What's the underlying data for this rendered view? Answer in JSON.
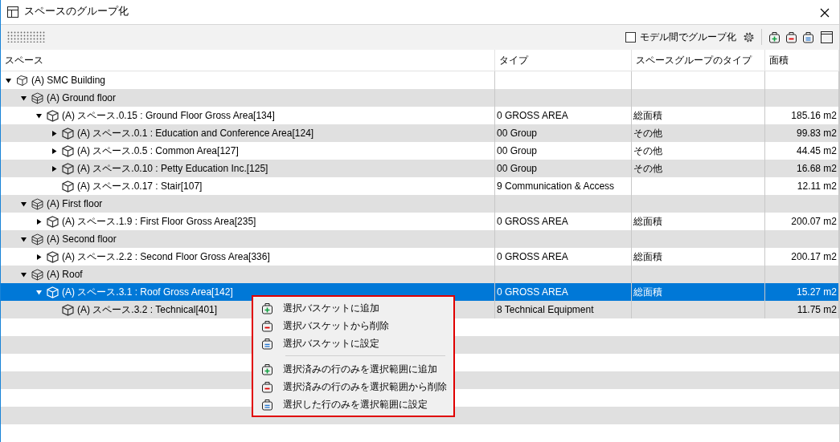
{
  "window": {
    "title": "スペースのグループ化"
  },
  "toolbar": {
    "cross_model": {
      "label": "モデル間でグループ化",
      "checked": false
    }
  },
  "table": {
    "columns": [
      "スペース",
      "タイプ",
      "スペースグループのタイプ",
      "面積"
    ],
    "rows": [
      {
        "kind": "building",
        "label": "(A) SMC Building",
        "expanded": true,
        "selected": false,
        "children": [
          {
            "kind": "floor",
            "label": "(A) Ground floor",
            "expanded": true,
            "selected": false,
            "children": [
              {
                "kind": "space",
                "label": "(A) スペース.0.15 : Ground Floor Gross Area[134]",
                "type": "0 GROSS AREA",
                "group_type": "総面積",
                "area": "185.16 m2",
                "expanded": true,
                "selected": false,
                "children": [
                  {
                    "kind": "space",
                    "label": "(A) スペース.0.1 : Education and Conference Area[124]",
                    "type": "00 Group",
                    "group_type": "その他",
                    "area": "99.83 m2",
                    "expanded": false,
                    "selected": false
                  },
                  {
                    "kind": "space",
                    "label": "(A) スペース.0.5 : Common Area[127]",
                    "type": "00 Group",
                    "group_type": "その他",
                    "area": "44.45 m2",
                    "expanded": false,
                    "selected": false
                  },
                  {
                    "kind": "space",
                    "label": "(A) スペース.0.10 : Petty Education Inc.[125]",
                    "type": "00 Group",
                    "group_type": "その他",
                    "area": "16.68 m2",
                    "expanded": false,
                    "selected": false
                  },
                  {
                    "kind": "space",
                    "label": "(A) スペース.0.17 : Stair[107]",
                    "type": "9 Communication & Access",
                    "area": "12.11 m2",
                    "selected": false
                  }
                ]
              }
            ]
          },
          {
            "kind": "floor",
            "label": "(A) First floor",
            "expanded": true,
            "selected": false,
            "children": [
              {
                "kind": "space",
                "label": "(A) スペース.1.9 : First Floor Gross Area[235]",
                "type": "0 GROSS AREA",
                "group_type": "総面積",
                "area": "200.07 m2",
                "expanded": false,
                "selected": false
              }
            ]
          },
          {
            "kind": "floor",
            "label": "(A) Second floor",
            "expanded": true,
            "selected": false,
            "children": [
              {
                "kind": "space",
                "label": "(A) スペース.2.2 : Second Floor Gross Area[336]",
                "type": "0 GROSS AREA",
                "group_type": "総面積",
                "area": "200.17 m2",
                "expanded": false,
                "selected": false
              }
            ]
          },
          {
            "kind": "floor",
            "label": "(A) Roof",
            "expanded": true,
            "selected": false,
            "children": [
              {
                "kind": "space",
                "label": "(A) スペース.3.1 : Roof Gross Area[142]",
                "type": "0 GROSS AREA",
                "group_type": "総面積",
                "area": "15.27 m2",
                "expanded": true,
                "selected": true,
                "children": [
                  {
                    "kind": "space",
                    "label": "(A) スペース.3.2 : Technical[401]",
                    "type": "8 Technical Equipment",
                    "area": "11.75 m2",
                    "selected": false
                  }
                ]
              }
            ]
          }
        ]
      }
    ]
  },
  "context_menu": {
    "groups": [
      [
        {
          "kind": "add",
          "label": "選択バスケットに追加"
        },
        {
          "kind": "remove",
          "label": "選択バスケットから削除"
        },
        {
          "kind": "set",
          "label": "選択バスケットに設定"
        }
      ],
      [
        {
          "kind": "add",
          "label": "選択済みの行のみを選択範囲に追加"
        },
        {
          "kind": "remove",
          "label": "選択済みの行のみを選択範囲から削除"
        },
        {
          "kind": "set",
          "label": "選択した行のみを選択範囲に設定"
        }
      ]
    ]
  }
}
